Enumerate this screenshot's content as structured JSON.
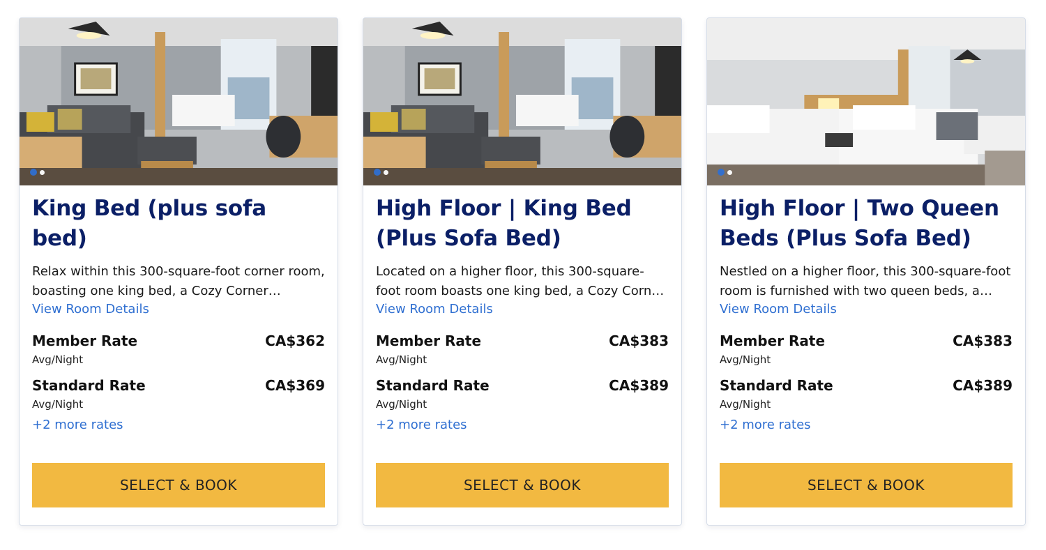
{
  "rooms": [
    {
      "title": "King Bed (plus sofa bed)",
      "description": "Relax within this 300-square-foot corner room, boasting one king bed, a Cozy Corner…",
      "details_link": "View Room Details",
      "rates": [
        {
          "name": "Member Rate",
          "price": "CA$362",
          "sub": "Avg/Night"
        },
        {
          "name": "Standard Rate",
          "price": "CA$369",
          "sub": "Avg/Night"
        }
      ],
      "more_rates": "+2 more rates",
      "book_label": "SELECT & BOOK",
      "carousel_active": 1
    },
    {
      "title": "High Floor | King Bed (Plus Sofa Bed)",
      "description": "Located on a higher floor, this 300-square-foot room boasts one king bed, a Cozy Corner wi…",
      "details_link": "View Room Details",
      "rates": [
        {
          "name": "Member Rate",
          "price": "CA$383",
          "sub": "Avg/Night"
        },
        {
          "name": "Standard Rate",
          "price": "CA$389",
          "sub": "Avg/Night"
        }
      ],
      "more_rates": "+2 more rates",
      "book_label": "SELECT & BOOK",
      "carousel_active": 1
    },
    {
      "title": "High Floor | Two Queen Beds (Plus Sofa Bed)",
      "description": "Nestled on a higher floor, this 300-square-foot room is furnished with two queen beds, a…",
      "details_link": "View Room Details",
      "rates": [
        {
          "name": "Member Rate",
          "price": "CA$383",
          "sub": "Avg/Night"
        },
        {
          "name": "Standard Rate",
          "price": "CA$389",
          "sub": "Avg/Night"
        }
      ],
      "more_rates": "+2 more rates",
      "book_label": "SELECT & BOOK",
      "carousel_active": 1
    }
  ],
  "colors": {
    "title": "#0b1f66",
    "link": "#2f6fd1",
    "button": "#f2b941",
    "card_border": "#d6dde8"
  }
}
